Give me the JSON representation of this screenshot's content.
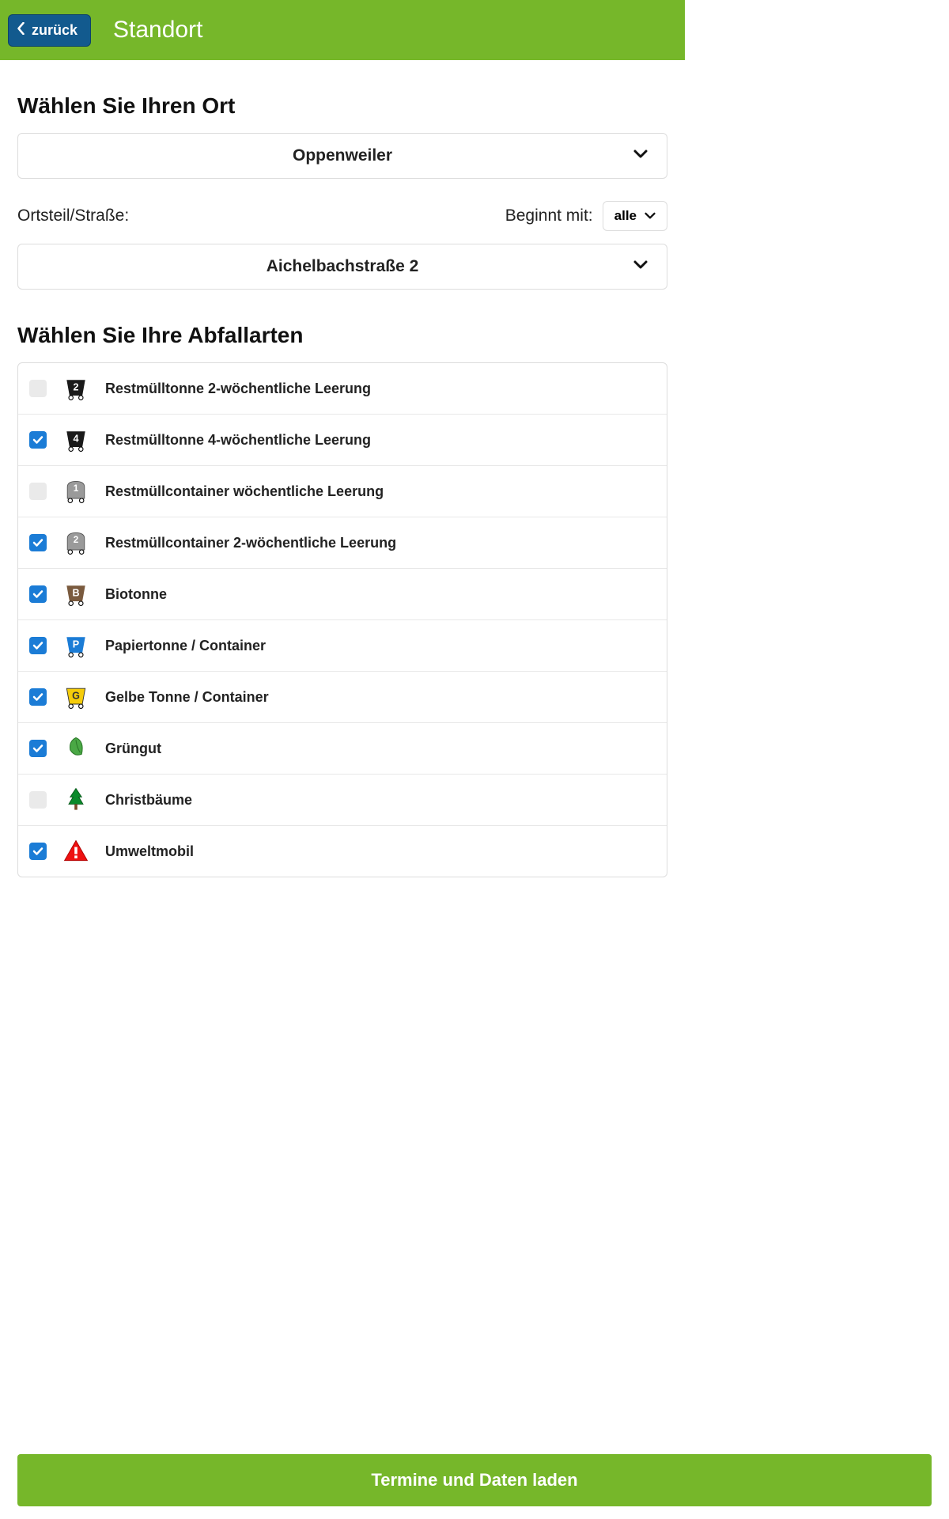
{
  "header": {
    "back_label": "zurück",
    "title": "Standort"
  },
  "location": {
    "title": "Wählen Sie Ihren Ort",
    "place_selected": "Oppenweiler",
    "district_label": "Ortsteil/Straße:",
    "begins_with_label": "Beginnt mit:",
    "begins_with_value": "alle",
    "street_selected": "Aichelbachstraße 2"
  },
  "waste": {
    "title": "Wählen Sie Ihre Abfallarten",
    "items": [
      {
        "label": "Restmülltonne 2-wöchentliche Leerung",
        "checked": false,
        "icon": "bin-2"
      },
      {
        "label": "Restmülltonne 4-wöchentliche Leerung",
        "checked": true,
        "icon": "bin-4"
      },
      {
        "label": "Restmüllcontainer wöchentliche Leerung",
        "checked": false,
        "icon": "container-1"
      },
      {
        "label": "Restmüllcontainer 2-wöchentliche Leerung",
        "checked": true,
        "icon": "container-2"
      },
      {
        "label": "Biotonne",
        "checked": true,
        "icon": "bio"
      },
      {
        "label": "Papiertonne / Container",
        "checked": true,
        "icon": "paper"
      },
      {
        "label": "Gelbe Tonne / Container",
        "checked": true,
        "icon": "yellow"
      },
      {
        "label": "Grüngut",
        "checked": true,
        "icon": "leaf"
      },
      {
        "label": "Christbäume",
        "checked": false,
        "icon": "tree"
      },
      {
        "label": "Umweltmobil",
        "checked": true,
        "icon": "warning"
      }
    ]
  },
  "footer": {
    "load_label": "Termine und Daten laden"
  }
}
